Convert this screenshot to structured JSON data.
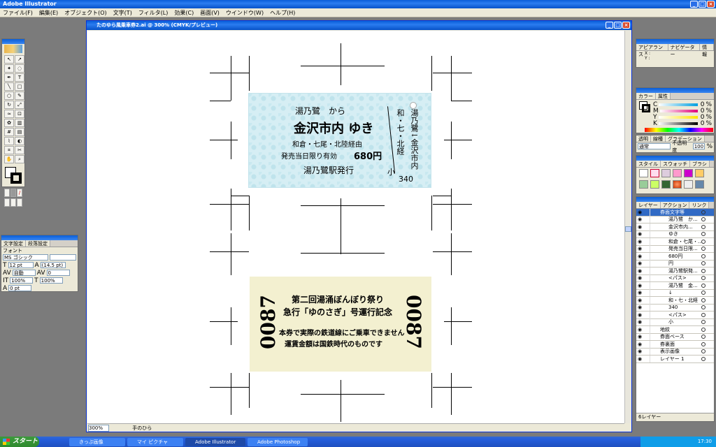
{
  "app": {
    "title": "Adobe Illustrator"
  },
  "menu": [
    "ファイル(F)",
    "編集(E)",
    "オブジェクト(O)",
    "文字(T)",
    "フィルタ(L)",
    "効果(C)",
    "画面(V)",
    "ウインドウ(W)",
    "ヘルプ(H)"
  ],
  "document": {
    "title": "たのゆら風乗車券2.ai @ 300% (CMYK/プレビュー)",
    "zoom": "300%",
    "status": "手のひら"
  },
  "ticket1": {
    "from": "湯乃鷺　から",
    "dest": "金沢市内 ゆき",
    "route": "和倉・七尾・北陸経由",
    "validity": "発売当日限り有効",
    "price": "680円",
    "issuer": "湯乃鷺駅発行",
    "side_route": "和・七・北経",
    "side_small": "小",
    "side_right": "湯乃鷺↓金沢市内",
    "number": "340"
  },
  "ticket2": {
    "line1": "第二回湯涌ぼんぼり祭り",
    "line2": "急行「ゆのさぎ」号運行記念",
    "line3": "本券で実際の鉄道線にご乗車できません",
    "line4": "運賃金額は国鉄時代のものです",
    "number": "0087"
  },
  "char_panel": {
    "tabs": [
      "文字設定",
      "段落設定"
    ],
    "font_label": "フォント",
    "font": "MS ゴシック",
    "style": "",
    "size": "12 pt",
    "leading": "(14.5 pt)",
    "tracking_auto": "自動",
    "kerning": "0",
    "vscale": "100%",
    "hscale": "100%",
    "baseline": "0 pt"
  },
  "nav_panel": {
    "tabs": [
      "アピアランス",
      "ナビゲーター",
      "情報"
    ],
    "x": "X :",
    "y": "Y :"
  },
  "color_panel": {
    "tabs": [
      "カラー",
      "属性"
    ],
    "labels": [
      "C",
      "M",
      "Y",
      "K"
    ],
    "values": [
      "0",
      "0",
      "0",
      "0"
    ],
    "unit": "%"
  },
  "trans_panel": {
    "tabs": [
      "透明",
      "線種",
      "グラデーション"
    ],
    "mode": "通常",
    "opacity_label": "不透明度",
    "opacity": "100",
    "unit": "%"
  },
  "style_panel": {
    "tabs": [
      "スタイル",
      "スウォッチ",
      "ブラシ"
    ]
  },
  "layers_panel": {
    "tabs": [
      "レイヤー",
      "アクション",
      "リンク"
    ],
    "count": "6レイヤー",
    "items": [
      {
        "name": "券面文字等",
        "level": 0
      },
      {
        "name": "湯乃鷺　か...",
        "level": 1
      },
      {
        "name": "金沢市内...",
        "level": 1
      },
      {
        "name": "ゆき",
        "level": 1
      },
      {
        "name": "和倉・七尾・...",
        "level": 1
      },
      {
        "name": "発売当日限...",
        "level": 1
      },
      {
        "name": "680円",
        "level": 1
      },
      {
        "name": "円",
        "level": 1
      },
      {
        "name": "湯乃鷺駅発...",
        "level": 1
      },
      {
        "name": "<パス>",
        "level": 1
      },
      {
        "name": "湯乃鷺　金...",
        "level": 1
      },
      {
        "name": "↓",
        "level": 1
      },
      {
        "name": "和・七・北経",
        "level": 1
      },
      {
        "name": "340",
        "level": 1
      },
      {
        "name": "<パス>",
        "level": 1
      },
      {
        "name": "小",
        "level": 1
      },
      {
        "name": "地紋",
        "level": 0
      },
      {
        "name": "券面ベース",
        "level": 0
      },
      {
        "name": "券裏面",
        "level": 0
      },
      {
        "name": "表示画像",
        "level": 0
      },
      {
        "name": "レイヤー 1",
        "level": 0
      }
    ]
  },
  "taskbar": {
    "start": "スタート",
    "tasks": [
      "きっぷ画像",
      "マイ ピクチャ",
      "Adobe Illustrator",
      "Adobe Photoshop"
    ],
    "time": "17:30"
  }
}
